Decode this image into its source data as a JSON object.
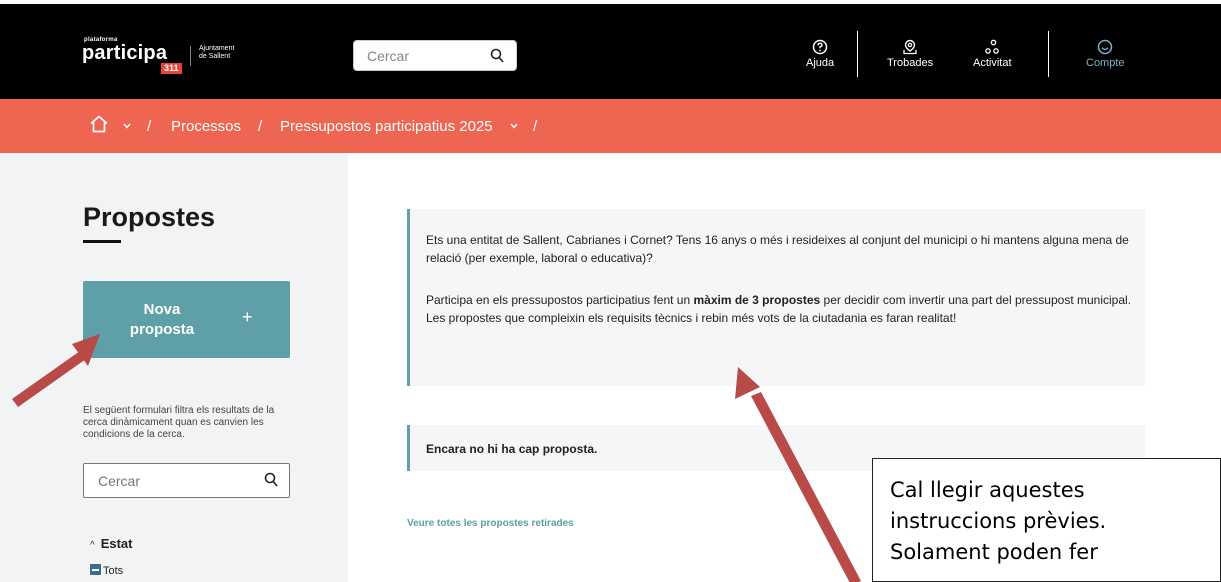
{
  "header": {
    "logo": {
      "small": "plataforma",
      "big": "participa",
      "num": "311",
      "ajunt_line1": "Ajuntament",
      "ajunt_line2": "de Sallent"
    },
    "search_placeholder": "Cercar",
    "nav": [
      {
        "label": "Ajuda",
        "icon": "help-icon"
      },
      {
        "label": "Trobades",
        "icon": "map-pin-icon"
      },
      {
        "label": "Activitat",
        "icon": "activity-icon"
      },
      {
        "label": "Compte",
        "icon": "account-icon"
      }
    ],
    "colors": {
      "bar": "#000000",
      "account_accent": "#7fb0c9"
    }
  },
  "breadcrumb": {
    "home_icon": "home-icon",
    "items": [
      "/",
      "Processos",
      "/",
      "Pressupostos participatius 2025",
      "/"
    ],
    "color": "#ee6552"
  },
  "sidebar": {
    "title": "Propostes",
    "new_button": "Nova proposta",
    "new_button_plus": "+",
    "filter_help": "El següent formulari filtra els resultats de la cerca dinàmicament quan es canvien les condicions de la cerca.",
    "search_placeholder": "Cercar",
    "estat_label": "Estat",
    "tots_label": "Tots",
    "accent": "#5f9fa7"
  },
  "main": {
    "callout_p1": "Ets una entitat de Sallent, Cabrianes i Cornet? Tens 16 anys o més i resideixes al conjunt del municipi o hi mantens alguna mena de relació (per exemple, laboral o educativa)?",
    "callout_p2_pre": "Participa en els pressupostos participatius fent un ",
    "callout_p2_bold": "màxim de 3 propostes",
    "callout_p2_post": " per decidir com invertir una part del pressupost municipal. Les propostes que compleixin els requisits tècnics i rebin més vots de la ciutadania es faran realitat!",
    "empty_message": "Encara no hi ha cap proposta.",
    "withdrawn_link": "Veure totes les propostes retirades"
  },
  "annotation": {
    "text": "Cal llegir aquestes instruccions prèvies. Solament poden fer",
    "arrow_color": "#b84a47"
  }
}
